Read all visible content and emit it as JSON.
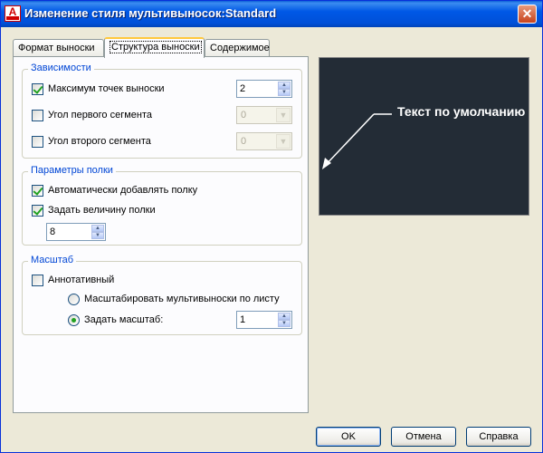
{
  "window": {
    "title": "Изменение стиля мультивыносок:Standard",
    "close_glyph": "✕"
  },
  "tabs": [
    {
      "label": "Формат выноски"
    },
    {
      "label": "Структура выноски",
      "active": true
    },
    {
      "label": "Содержимое"
    }
  ],
  "constraints": {
    "legend": "Зависимости",
    "max_points": {
      "label": "Максимум точек выноски",
      "checked": true,
      "value": "2"
    },
    "first_segment": {
      "label": "Угол первого сегмента",
      "checked": false,
      "value": "0"
    },
    "second_segment": {
      "label": "Угол второго сегмента",
      "checked": false,
      "value": "0"
    }
  },
  "landing": {
    "legend": "Параметры полки",
    "auto_include": {
      "label": "Автоматически добавлять полку",
      "checked": true
    },
    "set_distance": {
      "label": "Задать величину полки",
      "checked": true
    },
    "distance_value": "8"
  },
  "scale": {
    "legend": "Масштаб",
    "annotative": {
      "label": "Аннотативный",
      "checked": false
    },
    "scale_to_layout": {
      "label": "Масштабировать мультивыноски по листу",
      "selected": false
    },
    "specify_scale": {
      "label": "Задать масштаб:",
      "selected": true,
      "value": "1"
    }
  },
  "preview": {
    "text": "Текст по умолчанию",
    "background": "#232c36"
  },
  "buttons": {
    "ok": "OK",
    "cancel": "Отмена",
    "help": "Справка"
  },
  "spinner_glyphs": {
    "up": "▲",
    "down": "▼"
  },
  "combo_glyph": "▼",
  "colors": {
    "titlebar": "#0058e6",
    "group_legend": "#0046d5",
    "check": "#21a121"
  }
}
